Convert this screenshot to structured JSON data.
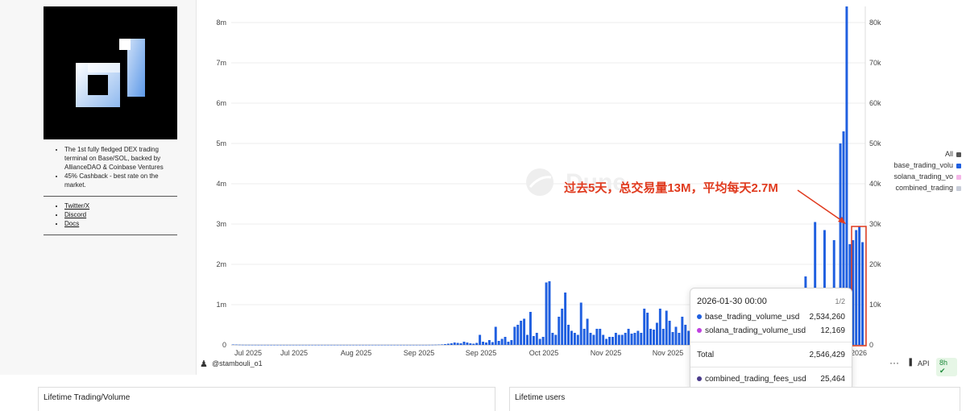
{
  "sidebar": {
    "bullets": [
      "The 1st fully fledged DEX trading terminal on Base/SOL, backed by AllianceDAO & Coinbase Ventures",
      "45% Cashback - best rate on the market."
    ],
    "links": [
      "Twitter/X",
      "Discord",
      "Docs"
    ]
  },
  "watermark": "Dune",
  "author": "@stambouli_o1",
  "footer": {
    "api_label": "API",
    "refresh_label": "8h"
  },
  "legend": {
    "all_label": "All",
    "items": [
      "base_trading_volu",
      "solana_trading_vo",
      "combined_trading"
    ],
    "colors": [
      "#1f5fe0",
      "#f5b6e8",
      "#c7ccd8"
    ]
  },
  "annotation": "过去5天，总交易量13M，平均每天2.7M",
  "tooltip": {
    "date": "2026-01-30 00:00",
    "page": "1/2",
    "rows": [
      {
        "label": "base_trading_volume_usd",
        "value": "2,534,260",
        "color": "#1f5fe0"
      },
      {
        "label": "solana_trading_volume_usd",
        "value": "12,169",
        "color": "#c040e0"
      }
    ],
    "total_label": "Total",
    "total_value": "2,546,429",
    "fees_label": "combined_trading_fees_usd",
    "fees_value": "25,464",
    "fees_color": "#4a3a8a"
  },
  "bottom_cards": [
    "Lifetime Trading/Volume",
    "Lifetime users"
  ],
  "chart_data": {
    "type": "bar",
    "left_axis_ticks": [
      "0",
      "1m",
      "2m",
      "3m",
      "4m",
      "5m",
      "6m",
      "7m",
      "8m"
    ],
    "right_axis_ticks": [
      "0",
      "10k",
      "20k",
      "30k",
      "40k",
      "50k",
      "60k",
      "70k",
      "80k"
    ],
    "x_tick_labels": [
      "Jul 2025",
      "Jul 2025",
      "Aug 2025",
      "Sep 2025",
      "Sep 2025",
      "Oct 2025",
      "Nov 2025",
      "Nov 2025",
      "2026"
    ],
    "ylim": [
      0,
      8400000
    ],
    "series": [
      {
        "name": "base_trading_volume_usd",
        "color": "#1f5fe0",
        "values": [
          10000,
          8000,
          5000,
          3000,
          2000,
          2000,
          1500,
          1500,
          1000,
          1000,
          1000,
          1000,
          1000,
          1000,
          1000,
          1000,
          1000,
          1000,
          1000,
          1000,
          1000,
          1000,
          1000,
          1000,
          1000,
          1000,
          1000,
          1000,
          1000,
          1000,
          1000,
          1000,
          1000,
          1000,
          1000,
          1000,
          1000,
          1000,
          1000,
          1000,
          1000,
          1000,
          1000,
          1000,
          1000,
          1000,
          1000,
          1000,
          1000,
          1000,
          1000,
          1000,
          1000,
          1000,
          1000,
          1000,
          1000,
          1000,
          1000,
          1000,
          1000,
          1000,
          2000,
          3000,
          5000,
          8000,
          12000,
          20000,
          30000,
          40000,
          60000,
          50000,
          40000,
          80000,
          60000,
          40000,
          30000,
          50000,
          250000,
          80000,
          60000,
          120000,
          70000,
          450000,
          100000,
          150000,
          200000,
          80000,
          120000,
          450000,
          500000,
          600000,
          650000,
          250000,
          820000,
          220000,
          300000,
          150000,
          200000,
          1550000,
          1580000,
          300000,
          250000,
          700000,
          900000,
          1300000,
          500000,
          350000,
          300000,
          250000,
          1050000,
          400000,
          650000,
          300000,
          250000,
          400000,
          400000,
          250000,
          150000,
          200000,
          200000,
          300000,
          250000,
          250000,
          300000,
          400000,
          280000,
          300000,
          350000,
          300000,
          900000,
          800000,
          400000,
          380000,
          550000,
          900000,
          400000,
          850000,
          600000,
          320000,
          450000,
          300000,
          700000,
          500000,
          350000,
          300000,
          500000,
          800000,
          700000,
          650000,
          350000,
          500000,
          1200000,
          900000,
          550000,
          400000,
          500000,
          350000,
          600000,
          450000,
          250000,
          300000,
          250000,
          200000,
          200000,
          200000,
          1000000,
          700000,
          450000,
          300000,
          350000,
          300000,
          450000,
          700000,
          500000,
          250000,
          400000,
          200000,
          300000,
          1150000,
          500000,
          1700000,
          400000,
          600000,
          3050000,
          700000,
          500000,
          2850000,
          600000,
          1000000,
          2600000,
          800000,
          5000000,
          5300000,
          8400000,
          2500000,
          2600000,
          2850000,
          2950000,
          2550000
        ]
      },
      {
        "name": "solana_trading_volume_usd",
        "color": "#f5b6e8",
        "values": []
      },
      {
        "name": "combined_trading_fees_usd",
        "color": "#c7ccd8",
        "values": []
      }
    ]
  }
}
